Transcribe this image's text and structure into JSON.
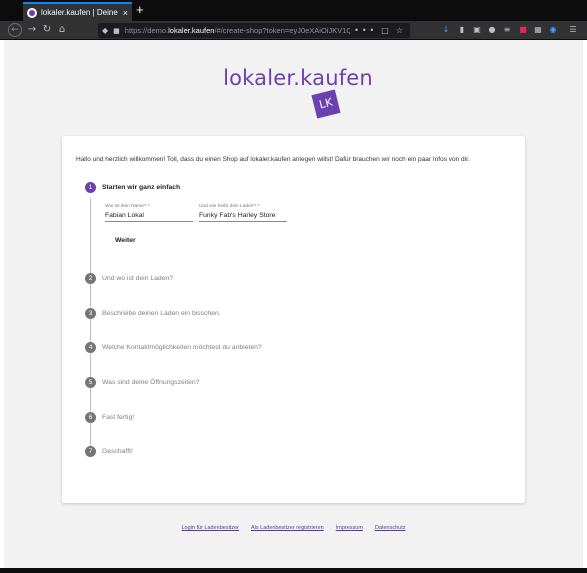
{
  "browser": {
    "tab_title": "lokaler.kaufen | Deine Pl…",
    "tab_close": "×",
    "new_tab": "+",
    "url_prefix": "https://demo.",
    "url_domain": "lokaler.kaufen",
    "url_suffix": "/#/create-shop?token=eyJ0eXAiOiJKV1Q",
    "url_actions": "•••"
  },
  "logo": {
    "text": "lokaler.kaufen",
    "badge": "LK",
    "color": "#6d40b0"
  },
  "intro": "Hallo und herzlich willkommen! Toll, dass du einen Shop auf lokaler.kaufen anlegen willst! Dafür brauchen wir noch ein paar Infos von dir.",
  "form": {
    "name_label": "Wie ist dein Name? *",
    "name_value": "Fabian Lokal",
    "shop_label": "Und wie heißt dein Laden? *",
    "shop_value": "Funky Fab's Harley Store",
    "next_button": "Weiter"
  },
  "steps": [
    {
      "num": "1",
      "label": "Starten wir ganz einfach"
    },
    {
      "num": "2",
      "label": "Und wo ist dein Laden?"
    },
    {
      "num": "3",
      "label": "Beschreibe deinen Laden ein bisschen."
    },
    {
      "num": "4",
      "label": "Welche Kontaktmöglichkeiten möchtest du anbieten?"
    },
    {
      "num": "5",
      "label": "Was sind deine Öffnungszeiten?"
    },
    {
      "num": "6",
      "label": "Fast fertig!"
    },
    {
      "num": "7",
      "label": "Geschafft!"
    }
  ],
  "footer": [
    "Login für Ladenbesitzer",
    "Als Ladenbesitzer registrieren",
    "Impressum",
    "Datenschutz"
  ],
  "colors": {
    "accent": "#6d40b0",
    "step_inactive": "#757575",
    "page_bg": "#f2f2f2",
    "browser_dark": "#0c0c0d"
  }
}
